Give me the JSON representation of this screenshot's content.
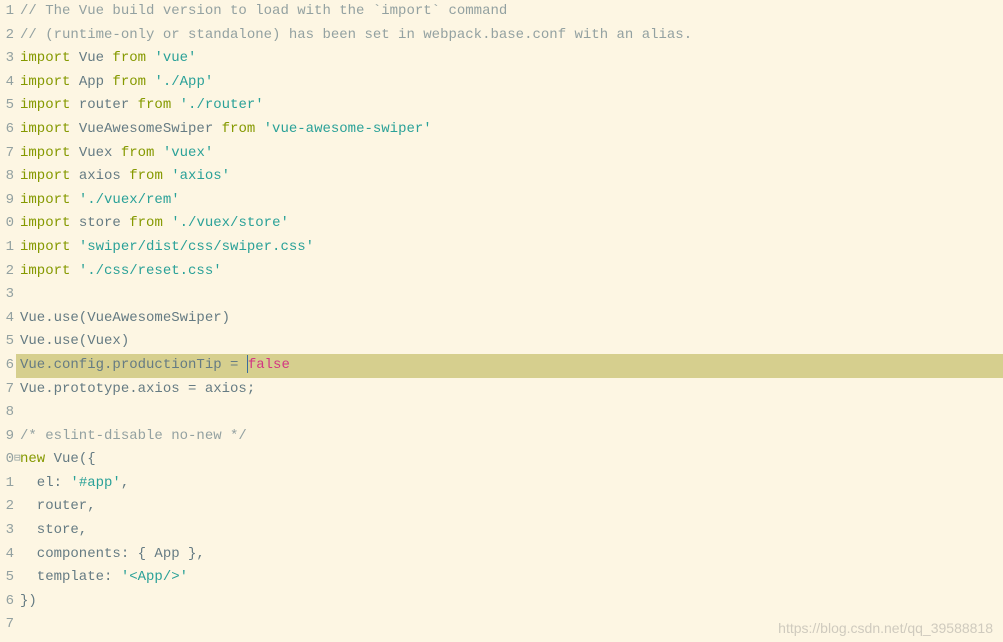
{
  "watermark": "https://blog.csdn.net/qq_39588818",
  "cursor_line_index": 15,
  "fold_marker_line_index": 19,
  "fold_marker": "⊟",
  "lines": [
    {
      "num": "1",
      "hl": false,
      "tokens": [
        {
          "t": "// The Vue build version to load with the `import` command",
          "c": "comment"
        }
      ]
    },
    {
      "num": "2",
      "hl": false,
      "tokens": [
        {
          "t": "// (runtime-only or standalone) has been set in webpack.base.conf with an alias.",
          "c": "comment"
        }
      ]
    },
    {
      "num": "3",
      "hl": false,
      "tokens": [
        {
          "t": "import ",
          "c": "keyword"
        },
        {
          "t": "Vue ",
          "c": "base"
        },
        {
          "t": "from ",
          "c": "keyword"
        },
        {
          "t": "'vue'",
          "c": "string"
        }
      ]
    },
    {
      "num": "4",
      "hl": false,
      "tokens": [
        {
          "t": "import ",
          "c": "keyword"
        },
        {
          "t": "App ",
          "c": "base"
        },
        {
          "t": "from ",
          "c": "keyword"
        },
        {
          "t": "'./App'",
          "c": "string"
        }
      ]
    },
    {
      "num": "5",
      "hl": false,
      "tokens": [
        {
          "t": "import ",
          "c": "keyword"
        },
        {
          "t": "router ",
          "c": "base"
        },
        {
          "t": "from ",
          "c": "keyword"
        },
        {
          "t": "'./router'",
          "c": "string"
        }
      ]
    },
    {
      "num": "6",
      "hl": false,
      "tokens": [
        {
          "t": "import ",
          "c": "keyword"
        },
        {
          "t": "VueAwesomeSwiper ",
          "c": "base"
        },
        {
          "t": "from ",
          "c": "keyword"
        },
        {
          "t": "'vue-awesome-swiper'",
          "c": "string"
        }
      ]
    },
    {
      "num": "7",
      "hl": false,
      "tokens": [
        {
          "t": "import ",
          "c": "keyword"
        },
        {
          "t": "Vuex ",
          "c": "base"
        },
        {
          "t": "from ",
          "c": "keyword"
        },
        {
          "t": "'vuex'",
          "c": "string"
        }
      ]
    },
    {
      "num": "8",
      "hl": false,
      "tokens": [
        {
          "t": "import ",
          "c": "keyword"
        },
        {
          "t": "axios ",
          "c": "base"
        },
        {
          "t": "from ",
          "c": "keyword"
        },
        {
          "t": "'axios'",
          "c": "string"
        }
      ]
    },
    {
      "num": "9",
      "hl": false,
      "tokens": [
        {
          "t": "import ",
          "c": "keyword"
        },
        {
          "t": "'./vuex/rem'",
          "c": "string"
        }
      ]
    },
    {
      "num": "0",
      "hl": false,
      "tokens": [
        {
          "t": "import ",
          "c": "keyword"
        },
        {
          "t": "store ",
          "c": "base"
        },
        {
          "t": "from ",
          "c": "keyword"
        },
        {
          "t": "'./vuex/store'",
          "c": "string"
        }
      ]
    },
    {
      "num": "1",
      "hl": false,
      "tokens": [
        {
          "t": "import ",
          "c": "keyword"
        },
        {
          "t": "'swiper/dist/css/swiper.css'",
          "c": "string"
        }
      ]
    },
    {
      "num": "2",
      "hl": false,
      "tokens": [
        {
          "t": "import ",
          "c": "keyword"
        },
        {
          "t": "'./css/reset.css'",
          "c": "string"
        }
      ]
    },
    {
      "num": "3",
      "hl": false,
      "tokens": [
        {
          "t": "",
          "c": "base"
        }
      ]
    },
    {
      "num": "4",
      "hl": false,
      "tokens": [
        {
          "t": "Vue.use(VueAwesomeSwiper)",
          "c": "base"
        }
      ]
    },
    {
      "num": "5",
      "hl": false,
      "tokens": [
        {
          "t": "Vue.use(Vuex)",
          "c": "base"
        }
      ]
    },
    {
      "num": "6",
      "hl": true,
      "tokens": [
        {
          "t": "Vue.config.productionTip = ",
          "c": "base"
        },
        {
          "t": "|CURSOR|",
          "c": "cursor"
        },
        {
          "t": "false",
          "c": "boolean"
        }
      ]
    },
    {
      "num": "7",
      "hl": false,
      "tokens": [
        {
          "t": "Vue.prototype.axios = axios;",
          "c": "base"
        }
      ]
    },
    {
      "num": "8",
      "hl": false,
      "tokens": [
        {
          "t": "",
          "c": "base"
        }
      ]
    },
    {
      "num": "9",
      "hl": false,
      "tokens": [
        {
          "t": "/* eslint-disable no-new */",
          "c": "comment"
        }
      ]
    },
    {
      "num": "0",
      "hl": false,
      "tokens": [
        {
          "t": "new ",
          "c": "keyword"
        },
        {
          "t": "Vue({",
          "c": "base"
        }
      ]
    },
    {
      "num": "1",
      "hl": false,
      "tokens": [
        {
          "t": "  el: ",
          "c": "base"
        },
        {
          "t": "'#app'",
          "c": "string"
        },
        {
          "t": ",",
          "c": "base"
        }
      ]
    },
    {
      "num": "2",
      "hl": false,
      "tokens": [
        {
          "t": "  router,",
          "c": "base"
        }
      ]
    },
    {
      "num": "3",
      "hl": false,
      "tokens": [
        {
          "t": "  store,",
          "c": "base"
        }
      ]
    },
    {
      "num": "4",
      "hl": false,
      "tokens": [
        {
          "t": "  components: { App },",
          "c": "base"
        }
      ]
    },
    {
      "num": "5",
      "hl": false,
      "tokens": [
        {
          "t": "  template: ",
          "c": "base"
        },
        {
          "t": "'<App/>'",
          "c": "string"
        }
      ]
    },
    {
      "num": "6",
      "hl": false,
      "tokens": [
        {
          "t": "})",
          "c": "base"
        }
      ]
    },
    {
      "num": "7",
      "hl": false,
      "tokens": [
        {
          "t": "",
          "c": "base"
        }
      ]
    }
  ]
}
